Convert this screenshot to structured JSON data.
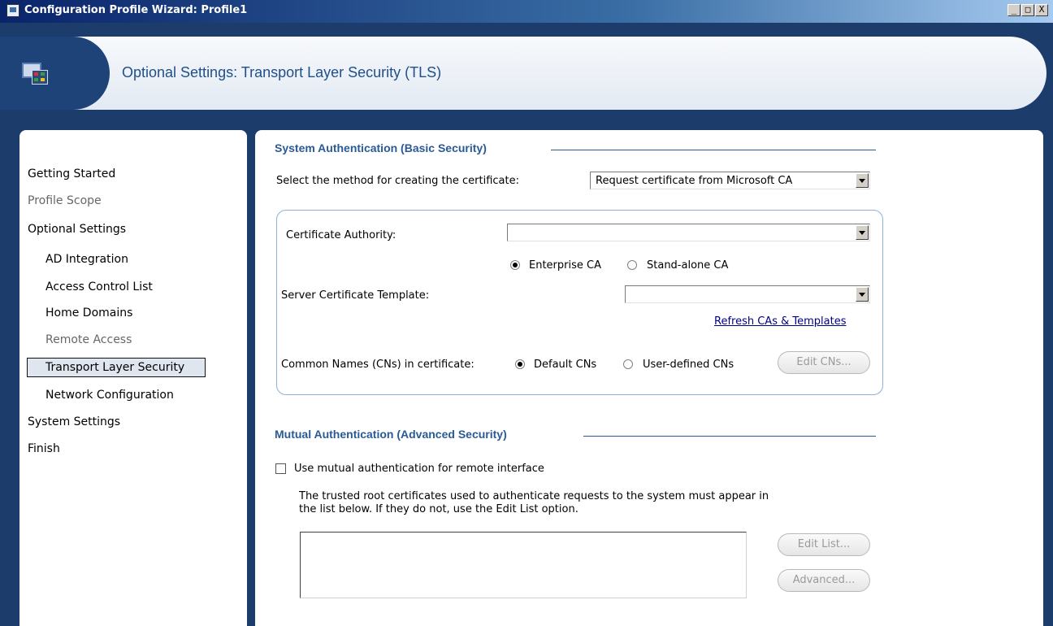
{
  "window": {
    "title": "Configuration Profile Wizard: Profile1",
    "controls": {
      "minimize": "_",
      "maximize": "□",
      "close": "X"
    }
  },
  "header": {
    "title": "Optional Settings: Transport Layer Security (TLS)",
    "icon": "wizard-icon"
  },
  "sidebar": {
    "items": [
      {
        "label": "Getting Started",
        "state": "normal"
      },
      {
        "label": "Profile Scope",
        "state": "disabled"
      },
      {
        "label": "Optional Settings",
        "state": "normal"
      },
      {
        "label": "AD Integration",
        "state": "normal"
      },
      {
        "label": "Access Control List",
        "state": "normal"
      },
      {
        "label": "Home Domains",
        "state": "normal"
      },
      {
        "label": "Remote Access",
        "state": "disabled"
      },
      {
        "label": "Transport Layer Security",
        "state": "selected"
      },
      {
        "label": "Network Configuration",
        "state": "normal"
      },
      {
        "label": "System Settings",
        "state": "normal"
      },
      {
        "label": "Finish",
        "state": "normal"
      }
    ]
  },
  "system_auth": {
    "title": "System Authentication (Basic Security)",
    "method_label": "Select the method for creating the certificate:",
    "method_value": "Request certificate from Microsoft CA",
    "ca_label": "Certificate Authority:",
    "ca_value": "",
    "enterprise_ca_label": "Enterprise CA",
    "standalone_ca_label": "Stand-alone CA",
    "ca_type_selected": "Enterprise CA",
    "template_label": "Server Certificate Template:",
    "template_value": "",
    "refresh_link": "Refresh CAs & Templates",
    "cn_label": "Common Names (CNs) in certificate:",
    "default_cns_label": "Default CNs",
    "user_cns_label": "User-defined  CNs",
    "cn_selected": "Default CNs",
    "edit_cns_button": "Edit CNs..."
  },
  "mutual_auth": {
    "title": "Mutual Authentication (Advanced Security)",
    "checkbox_label": "Use mutual authentication for remote interface",
    "checked": false,
    "description_line1": "The trusted root certificates used to authenticate requests to the system must appear in",
    "description_line2": "the list below. If they do not, use the Edit List option.",
    "edit_list_button": "Edit List...",
    "advanced_button": "Advanced..."
  },
  "colors": {
    "frame": "#1c3d6b",
    "accent": "#2a5a95",
    "link": "#00008b"
  }
}
